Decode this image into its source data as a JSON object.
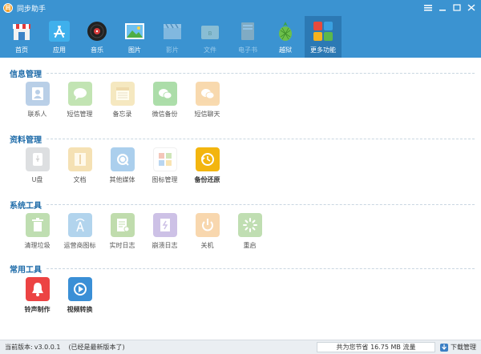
{
  "window": {
    "title": "同步助手",
    "logo_glyph": "同"
  },
  "toolbar": {
    "items": [
      {
        "label": "首页",
        "state": "normal"
      },
      {
        "label": "应用",
        "state": "normal"
      },
      {
        "label": "音乐",
        "state": "normal"
      },
      {
        "label": "图片",
        "state": "normal"
      },
      {
        "label": "影片",
        "state": "disabled"
      },
      {
        "label": "文件",
        "state": "disabled"
      },
      {
        "label": "电子书",
        "state": "disabled"
      },
      {
        "label": "越狱",
        "state": "normal"
      },
      {
        "label": "更多功能",
        "state": "active"
      }
    ]
  },
  "sections": [
    {
      "title": "信息管理",
      "tiles": [
        {
          "label": "联系人",
          "icon": "contacts-icon",
          "color": "#5b8fc7",
          "dim": true
        },
        {
          "label": "短信管理",
          "icon": "sms-icon",
          "color": "#6fbf4b",
          "dim": true
        },
        {
          "label": "备忘录",
          "icon": "notes-icon",
          "color": "#e9c96a",
          "dim": true
        },
        {
          "label": "微信备份",
          "icon": "wechat-icon",
          "color": "#3cb034",
          "dim": true
        },
        {
          "label": "短信聊天",
          "icon": "chat-icon",
          "color": "#f0a640",
          "dim": true
        }
      ]
    },
    {
      "title": "资料管理",
      "tiles": [
        {
          "label": "U盘",
          "icon": "usb-drive-icon",
          "color": "#b0b4ba",
          "dim": true
        },
        {
          "label": "文档",
          "icon": "document-icon",
          "color": "#e8b84f",
          "dim": true
        },
        {
          "label": "其他媒体",
          "icon": "media-icon",
          "color": "#3a8fd6",
          "dim": true
        },
        {
          "label": "图标管理",
          "icon": "icon-manage-icon",
          "color": "#e77a5a",
          "dim": true
        },
        {
          "label": "备份还原",
          "icon": "backup-restore-icon",
          "color": "#f3b50f",
          "dim": false
        }
      ]
    },
    {
      "title": "系统工具",
      "tiles": [
        {
          "label": "清理垃圾",
          "icon": "trash-icon",
          "color": "#69b347",
          "dim": true
        },
        {
          "label": "运营商图标",
          "icon": "carrier-icon",
          "color": "#4a9ad6",
          "dim": true
        },
        {
          "label": "实时日志",
          "icon": "realtime-log-icon",
          "color": "#6cae3e",
          "dim": true
        },
        {
          "label": "崩溃日志",
          "icon": "crash-log-icon",
          "color": "#8a6dc4",
          "dim": true
        },
        {
          "label": "关机",
          "icon": "power-icon",
          "color": "#f0a140",
          "dim": true
        },
        {
          "label": "重启",
          "icon": "restart-icon",
          "color": "#6bb14a",
          "dim": true
        }
      ]
    },
    {
      "title": "常用工具",
      "tiles": [
        {
          "label": "铃声制作",
          "icon": "ringtone-icon",
          "color": "#ec4343",
          "dim": false
        },
        {
          "label": "视频转换",
          "icon": "video-convert-icon",
          "color": "#3a8fd6",
          "dim": false
        }
      ]
    }
  ],
  "status": {
    "version_label": "当前版本:",
    "version_value": "v3.0.0.1",
    "latest_note": "(已经是最新版本了)",
    "saved_traffic": "共为您节省 16.75 MB 流量",
    "download_label": "下载管理"
  }
}
